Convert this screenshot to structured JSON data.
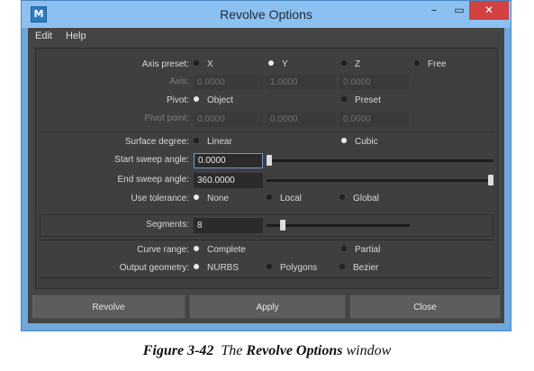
{
  "window": {
    "title": "Revolve Options",
    "app_icon_letter": "M",
    "minimize_glyph": "–",
    "maximize_glyph": "▭",
    "close_glyph": "✕"
  },
  "menu": [
    "Edit",
    "Help"
  ],
  "axis_preset": {
    "label": "Axis preset:",
    "options": [
      "X",
      "Y",
      "Z",
      "Free"
    ],
    "selected": "Y"
  },
  "axis": {
    "label": "Axis:",
    "values": [
      "0.0000",
      "1.0000",
      "0.0000"
    ]
  },
  "pivot": {
    "label": "Pivot:",
    "options": [
      "Object",
      "Preset"
    ],
    "selected": "Object"
  },
  "pivot_point": {
    "label": "Pivot point:",
    "values": [
      "0.0000",
      "0.0000",
      "0.0000"
    ]
  },
  "surface_degree": {
    "label": "Surface degree:",
    "options": [
      "Linear",
      "Cubic"
    ],
    "selected": "Cubic"
  },
  "start_sweep": {
    "label": "Start sweep angle:",
    "value": "0.0000",
    "slider_fraction": 0.0
  },
  "end_sweep": {
    "label": "End sweep angle:",
    "value": "360.0000",
    "slider_fraction": 1.0
  },
  "use_tolerance": {
    "label": "Use tolerance:",
    "options": [
      "None",
      "Local",
      "Global"
    ],
    "selected": "None"
  },
  "segments": {
    "label": "Segments:",
    "value": "8",
    "slider_fraction": 0.1
  },
  "curve_range": {
    "label": "Curve range:",
    "options": [
      "Complete",
      "Partial"
    ],
    "selected": "Complete"
  },
  "output_geometry": {
    "label": "Output geometry:",
    "options": [
      "NURBS",
      "Polygons",
      "Bezier"
    ],
    "selected": "NURBS"
  },
  "buttons": {
    "revolve": "Revolve",
    "apply": "Apply",
    "close": "Close"
  },
  "caption": {
    "figure": "Figure 3-42",
    "pre": "The",
    "bold": "Revolve Options",
    "post": "window"
  },
  "colors": {
    "panel_bg": "#444444",
    "title_bar": "#8cc0f0",
    "focus_border": "#6a9ad4",
    "close_button": "#d24040"
  }
}
